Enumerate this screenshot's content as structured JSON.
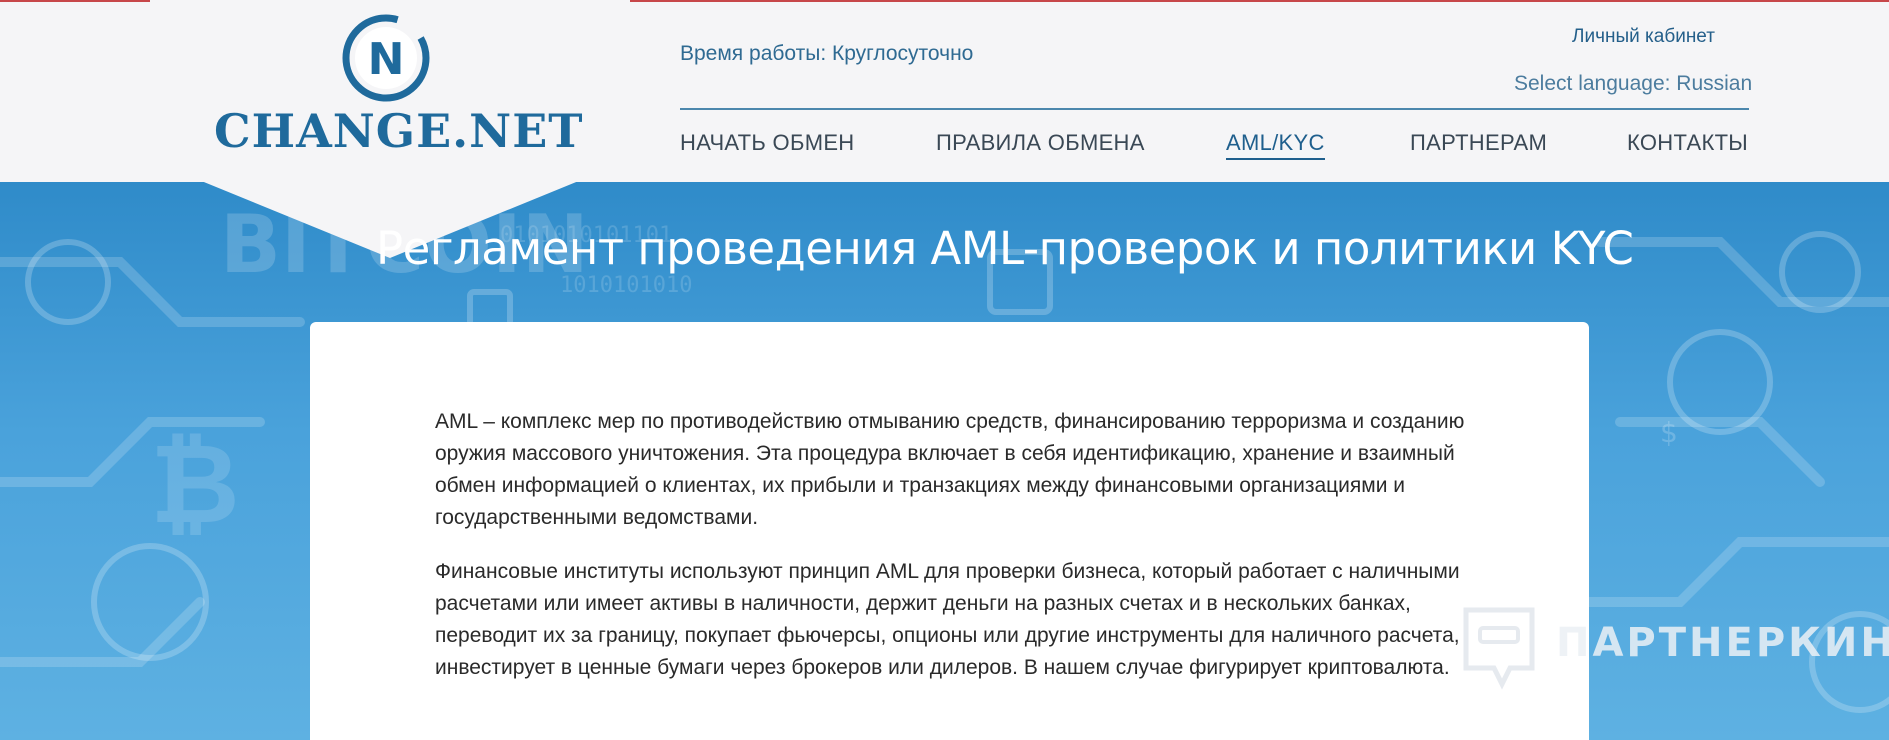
{
  "header": {
    "logo_text": "CHANGE.NET",
    "logo_letter": "N",
    "work_hours": "Время работы: Круглосуточно",
    "cabinet_link": "Личный кабинет",
    "language": "Select language: Russian"
  },
  "nav": [
    {
      "label": "НАЧАТЬ ОБМЕН",
      "active": false
    },
    {
      "label": "ПРАВИЛА ОБМЕНА",
      "active": false
    },
    {
      "label": "AML/KYC",
      "active": true
    },
    {
      "label": "ПАРТНЕРАМ",
      "active": false
    },
    {
      "label": "КОНТАКТЫ",
      "active": false
    }
  ],
  "hero": {
    "title": "Регламент проведения AML-проверок и политики KYC",
    "background_words": [
      "BITCOIN"
    ]
  },
  "content": {
    "paragraphs": [
      "AML – комплекс мер по противодействию отмыванию средств, финансированию терроризма и созданию оружия массового уничтожения. Эта процедура включает в себя идентификацию, хранение и взаимный обмен информацией о клиентах, их прибыли и транзакциях между финансовыми организациями и государственными ведомствами.",
      "Финансовые институты используют принцип AML для проверки бизнеса, который работает с наличными расчетами или имеет активы в наличности, держит деньги на разных счетах и в нескольких банках, переводит их за границу, покупает фьючерсы, опционы или другие инструменты для наличного расчета, инвестирует в ценные бумаги через брокеров или дилеров. В нашем случае фигурирует криптовалюта."
    ]
  },
  "watermark": {
    "text": "ПАРТНЕРКИН",
    "icon": "partnerkin-logo-icon"
  },
  "colors": {
    "brand": "#1f6a9c",
    "nav_active": "#1f5f8d",
    "hero_blue": "#3f98d4"
  }
}
